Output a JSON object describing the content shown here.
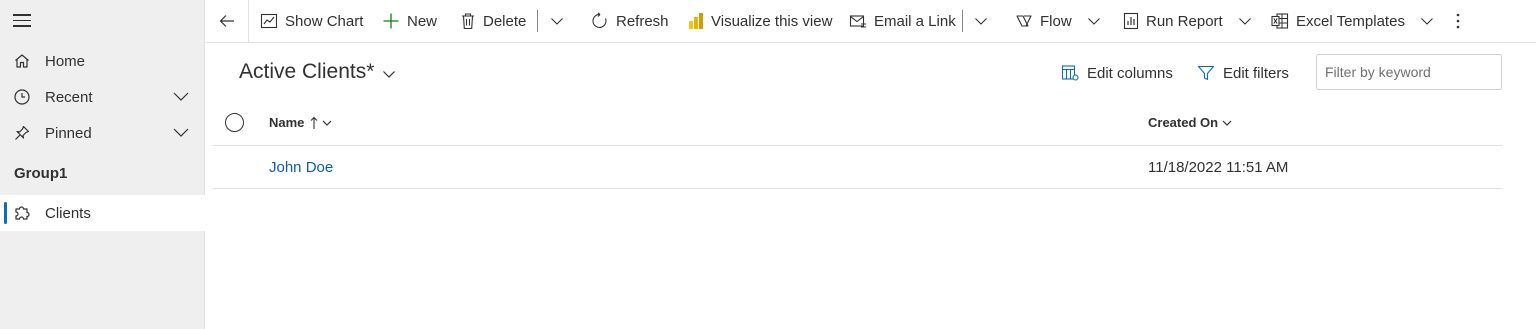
{
  "sidebar": {
    "menu_icon": "hamburger-icon",
    "items": [
      {
        "label": "Home",
        "icon": "home-icon"
      },
      {
        "label": "Recent",
        "icon": "clock-icon"
      },
      {
        "label": "Pinned",
        "icon": "pin-icon"
      }
    ],
    "group_title": "Group1",
    "group_items": [
      {
        "label": "Clients",
        "icon": "puzzle-icon",
        "selected": true
      }
    ],
    "accent_color": "#0f6cbd"
  },
  "commandbar": {
    "back_icon": "back-arrow-icon",
    "show_chart": "Show Chart",
    "new": "New",
    "delete": "Delete",
    "refresh": "Refresh",
    "visualize": "Visualize this view",
    "email_link": "Email a Link",
    "flow": "Flow",
    "run_report": "Run Report",
    "excel_templates": "Excel Templates",
    "more_icon": "more-vertical-icon"
  },
  "view": {
    "title": "Active Clients*",
    "edit_columns": "Edit columns",
    "edit_filters": "Edit filters",
    "filter_placeholder": "Filter by keyword",
    "filter_value": ""
  },
  "grid": {
    "columns": [
      {
        "label": "Name",
        "sort": "ascending"
      },
      {
        "label": "Created On"
      }
    ],
    "rows": [
      {
        "name": "John Doe",
        "created_on": "11/18/2022 11:51 AM"
      }
    ],
    "link_color": "#115ea3"
  }
}
